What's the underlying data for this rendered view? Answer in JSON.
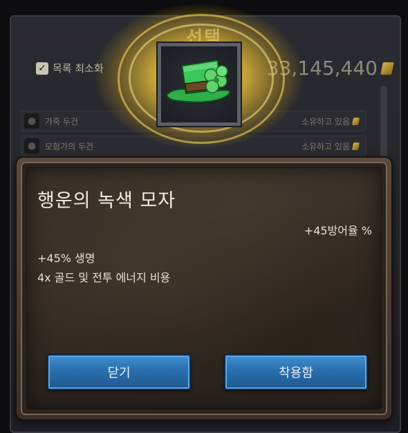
{
  "background_shop": {
    "title": "선택",
    "minimize_label": "목록 최소화",
    "gold": "33,145,440",
    "rows": [
      {
        "name": "가죽 두건",
        "status": "소유하고 있음"
      },
      {
        "name": "모험가의 두건",
        "status": "소유하고 있음"
      }
    ]
  },
  "item": {
    "name": "행운의 녹색 모자",
    "icon": "green-clover-hat-icon",
    "stats": {
      "armor": "+45방어율 %",
      "life": "+45% 생명",
      "cost": "4x 골드 및 전투 에너지 비용"
    }
  },
  "buttons": {
    "close_label": "닫기",
    "equip_label": "착용함"
  },
  "colors": {
    "glow": "#ffd84a",
    "button": "#2a6fad",
    "dialog_frame": "#7a6453"
  }
}
